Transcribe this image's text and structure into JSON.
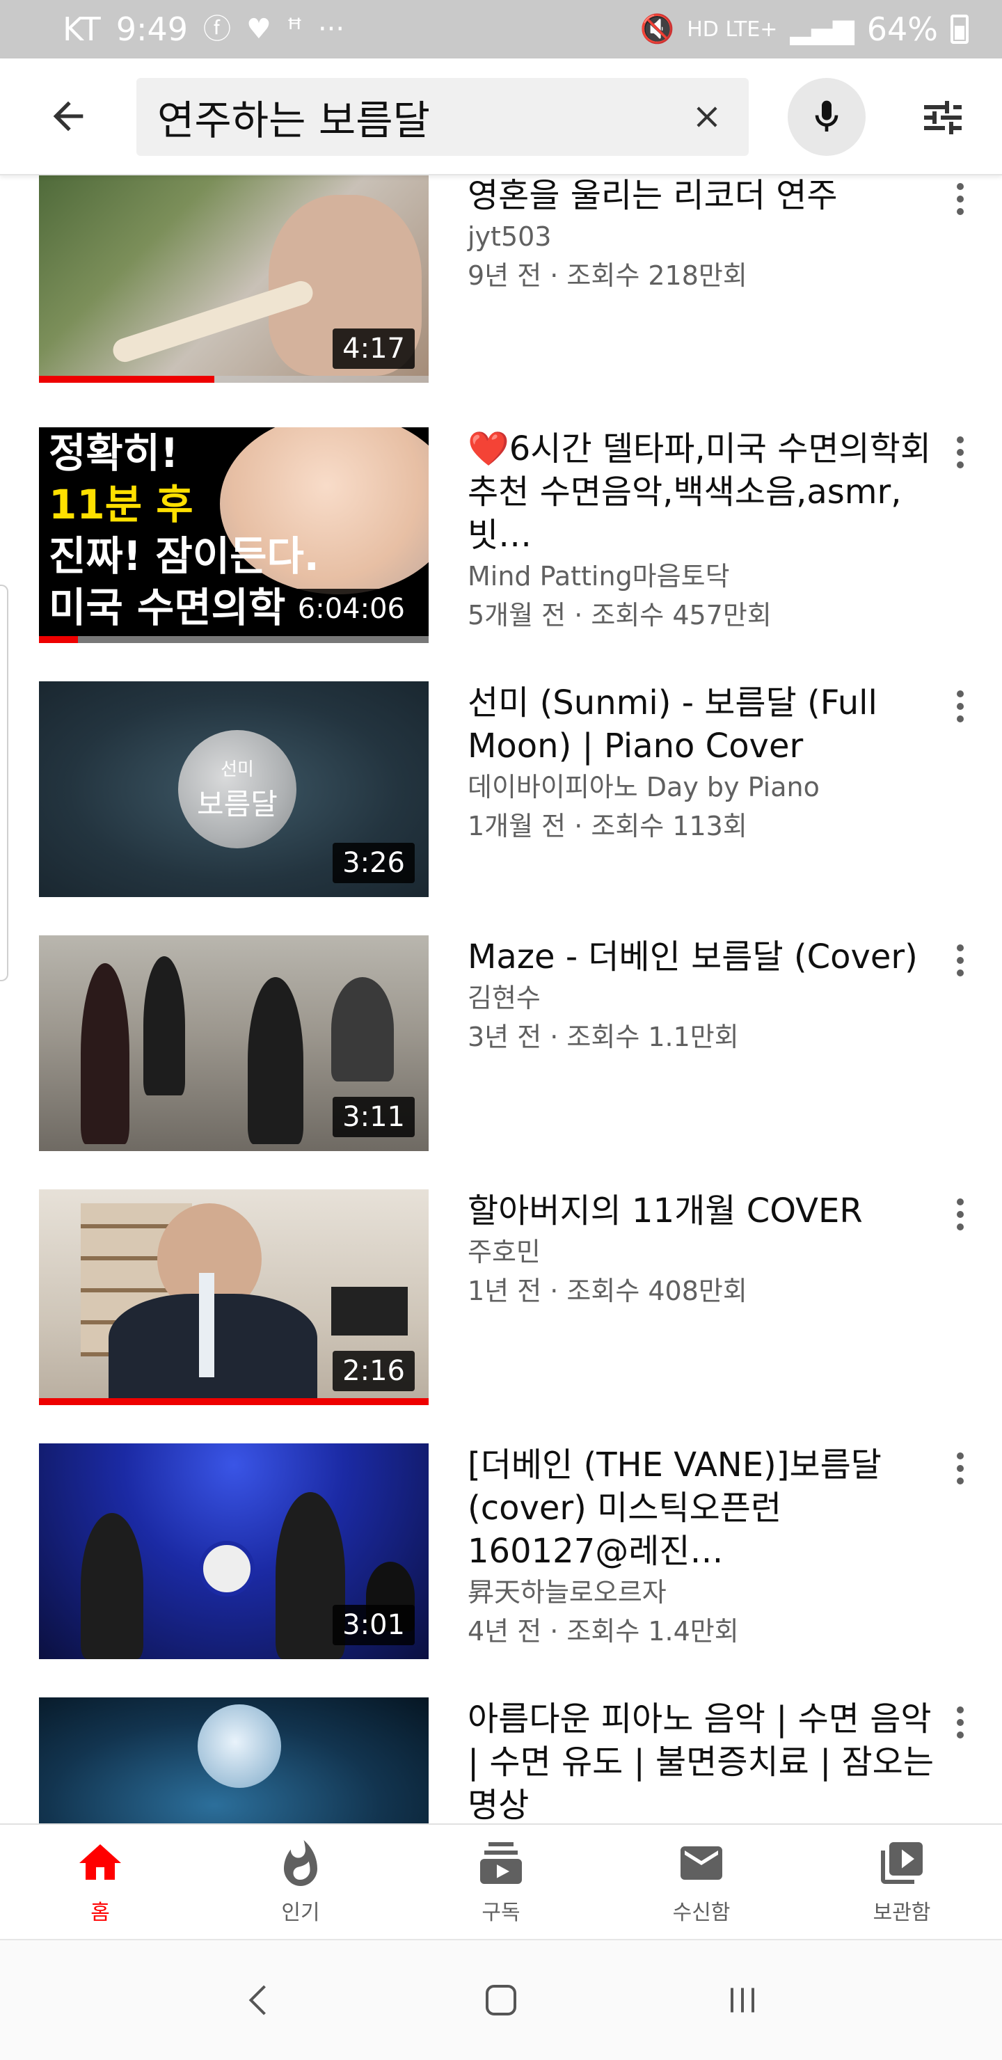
{
  "status_bar": {
    "carrier": "KT",
    "time": "9:49",
    "dots": "···",
    "network": "HD LTE+",
    "battery": "64%"
  },
  "search": {
    "query": "연주하는 보름달"
  },
  "videos": [
    {
      "title": "영혼을 울리는 리코더 연주",
      "channel": "jyt503",
      "stats": "9년 전 · 조회수 218만회",
      "duration": "4:17",
      "watched_fraction": 0.45
    },
    {
      "title_heart": "❤️",
      "title": "6시간 델타파,미국 수면의학회 추천 수면음악,백색소음,asmr,빗…",
      "channel": "Mind Patting마음토닥",
      "stats": "5개월 전 · 조회수 457만회",
      "duration": "6:04:06",
      "watched_fraction": 0.1,
      "thumb_text": [
        "정확히!",
        "11분 후",
        "진짜! 잠이든다.",
        "미국 수면의학"
      ]
    },
    {
      "title": "선미 (Sunmi) - 보름달 (Full Moon) | Piano Cover",
      "channel": "데이바이피아노 Day by Piano",
      "stats": "1개월 전 · 조회수 113회",
      "duration": "3:26",
      "thumb_text": [
        "선미",
        "보름달"
      ]
    },
    {
      "title": "Maze - 더베인 보름달 (Cover)",
      "channel": "김현수",
      "stats": "3년 전 · 조회수 1.1만회",
      "duration": "3:11"
    },
    {
      "title": "할아버지의 11개월 COVER",
      "channel": "주호민",
      "stats": "1년 전 · 조회수 408만회",
      "duration": "2:16",
      "watched_fraction": 1.0
    },
    {
      "title": "[더베인 (THE VANE)]보름달(cover) 미스틱오픈런160127@레진…",
      "channel": "昇天하늘로오르자",
      "stats": "4년 전 · 조회수 1.4만회",
      "duration": "3:01"
    },
    {
      "title": "아름다운 피아노 음악 | 수면 음악 | 수면 유도 | 불면증치료 | 잠오는 명상",
      "channel": "",
      "stats": ""
    }
  ],
  "bottom_nav": [
    {
      "label": "홈",
      "icon": "home-icon",
      "active": true
    },
    {
      "label": "인기",
      "icon": "fire-icon",
      "active": false
    },
    {
      "label": "구독",
      "icon": "subscriptions-icon",
      "active": false
    },
    {
      "label": "수신함",
      "icon": "mail-icon",
      "active": false
    },
    {
      "label": "보관함",
      "icon": "library-icon",
      "active": false
    }
  ],
  "colors": {
    "accent": "#ff0000",
    "secondary_text": "#606060",
    "status_bar": "#c9c9c9"
  }
}
